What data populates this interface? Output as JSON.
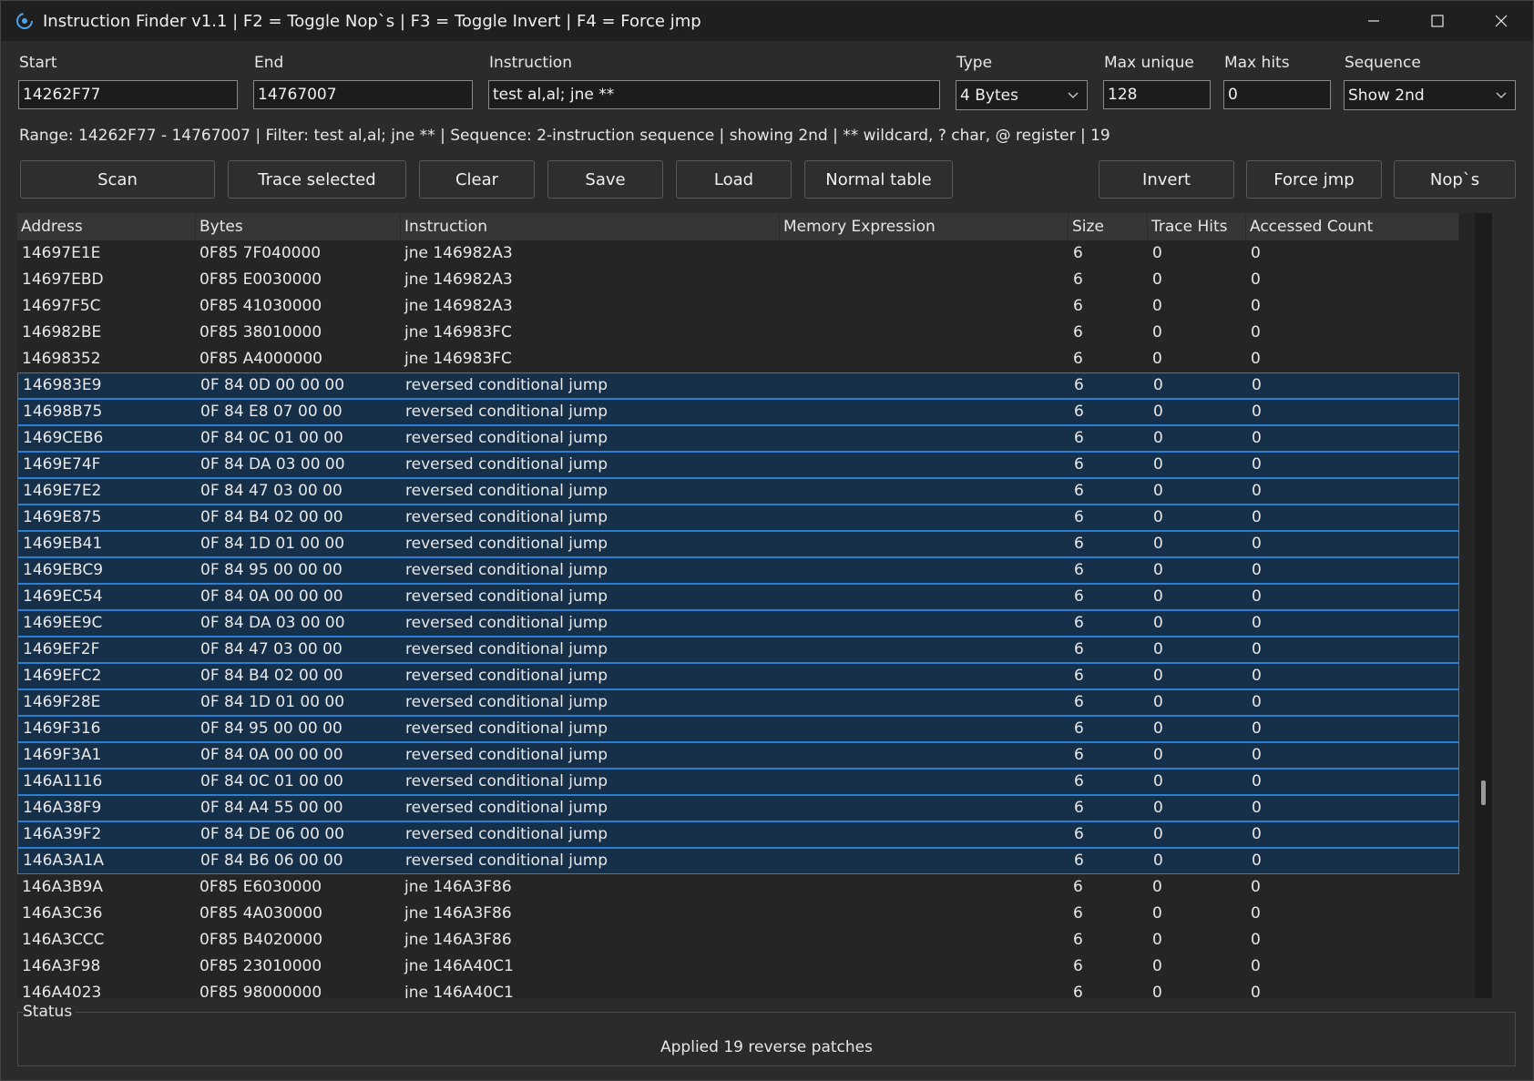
{
  "window": {
    "title": "Instruction Finder v1.1 | F2 = Toggle Nop`s | F3 = Toggle Invert | F4 = Force jmp"
  },
  "fields": {
    "start_label": "Start",
    "start_value": "14262F77",
    "end_label": "End",
    "end_value": "14767007",
    "instruction_label": "Instruction",
    "instruction_value": "test al,al; jne **",
    "type_label": "Type",
    "type_value": "4 Bytes",
    "max_unique_label": "Max unique",
    "max_unique_value": "128",
    "max_hits_label": "Max hits",
    "max_hits_value": "0",
    "sequence_label": "Sequence",
    "sequence_value": "Show 2nd"
  },
  "info": "Range: 14262F77 - 14767007 | Filter: test al,al; jne ** | Sequence: 2-instruction sequence | showing 2nd | ** wildcard, ? char, @ register | 19",
  "buttons": {
    "scan": "Scan",
    "trace": "Trace selected",
    "clear": "Clear",
    "save": "Save",
    "load": "Load",
    "normal_table": "Normal table",
    "invert": "Invert",
    "force_jmp": "Force jmp",
    "nops": "Nop`s"
  },
  "table": {
    "columns": [
      "Address",
      "Bytes",
      "Instruction",
      "Memory Expression",
      "Size",
      "Trace Hits",
      "Accessed Count"
    ],
    "rows": [
      {
        "address": "14697E1E",
        "bytes": "0F85 7F040000",
        "instruction": "jne 146982A3",
        "mem": "",
        "size": "6",
        "hits": "0",
        "count": "0",
        "selected": false
      },
      {
        "address": "14697EBD",
        "bytes": "0F85 E0030000",
        "instruction": "jne 146982A3",
        "mem": "",
        "size": "6",
        "hits": "0",
        "count": "0",
        "selected": false
      },
      {
        "address": "14697F5C",
        "bytes": "0F85 41030000",
        "instruction": "jne 146982A3",
        "mem": "",
        "size": "6",
        "hits": "0",
        "count": "0",
        "selected": false
      },
      {
        "address": "146982BE",
        "bytes": "0F85 38010000",
        "instruction": "jne 146983FC",
        "mem": "",
        "size": "6",
        "hits": "0",
        "count": "0",
        "selected": false
      },
      {
        "address": "14698352",
        "bytes": "0F85 A4000000",
        "instruction": "jne 146983FC",
        "mem": "",
        "size": "6",
        "hits": "0",
        "count": "0",
        "selected": false
      },
      {
        "address": "146983E9",
        "bytes": "0F 84 0D 00 00 00",
        "instruction": "reversed conditional jump",
        "mem": "",
        "size": "6",
        "hits": "0",
        "count": "0",
        "selected": true
      },
      {
        "address": "14698B75",
        "bytes": "0F 84 E8 07 00 00",
        "instruction": "reversed conditional jump",
        "mem": "",
        "size": "6",
        "hits": "0",
        "count": "0",
        "selected": true
      },
      {
        "address": "1469CEB6",
        "bytes": "0F 84 0C 01 00 00",
        "instruction": "reversed conditional jump",
        "mem": "",
        "size": "6",
        "hits": "0",
        "count": "0",
        "selected": true
      },
      {
        "address": "1469E74F",
        "bytes": "0F 84 DA 03 00 00",
        "instruction": "reversed conditional jump",
        "mem": "",
        "size": "6",
        "hits": "0",
        "count": "0",
        "selected": true
      },
      {
        "address": "1469E7E2",
        "bytes": "0F 84 47 03 00 00",
        "instruction": "reversed conditional jump",
        "mem": "",
        "size": "6",
        "hits": "0",
        "count": "0",
        "selected": true
      },
      {
        "address": "1469E875",
        "bytes": "0F 84 B4 02 00 00",
        "instruction": "reversed conditional jump",
        "mem": "",
        "size": "6",
        "hits": "0",
        "count": "0",
        "selected": true
      },
      {
        "address": "1469EB41",
        "bytes": "0F 84 1D 01 00 00",
        "instruction": "reversed conditional jump",
        "mem": "",
        "size": "6",
        "hits": "0",
        "count": "0",
        "selected": true
      },
      {
        "address": "1469EBC9",
        "bytes": "0F 84 95 00 00 00",
        "instruction": "reversed conditional jump",
        "mem": "",
        "size": "6",
        "hits": "0",
        "count": "0",
        "selected": true
      },
      {
        "address": "1469EC54",
        "bytes": "0F 84 0A 00 00 00",
        "instruction": "reversed conditional jump",
        "mem": "",
        "size": "6",
        "hits": "0",
        "count": "0",
        "selected": true
      },
      {
        "address": "1469EE9C",
        "bytes": "0F 84 DA 03 00 00",
        "instruction": "reversed conditional jump",
        "mem": "",
        "size": "6",
        "hits": "0",
        "count": "0",
        "selected": true
      },
      {
        "address": "1469EF2F",
        "bytes": "0F 84 47 03 00 00",
        "instruction": "reversed conditional jump",
        "mem": "",
        "size": "6",
        "hits": "0",
        "count": "0",
        "selected": true
      },
      {
        "address": "1469EFC2",
        "bytes": "0F 84 B4 02 00 00",
        "instruction": "reversed conditional jump",
        "mem": "",
        "size": "6",
        "hits": "0",
        "count": "0",
        "selected": true
      },
      {
        "address": "1469F28E",
        "bytes": "0F 84 1D 01 00 00",
        "instruction": "reversed conditional jump",
        "mem": "",
        "size": "6",
        "hits": "0",
        "count": "0",
        "selected": true
      },
      {
        "address": "1469F316",
        "bytes": "0F 84 95 00 00 00",
        "instruction": "reversed conditional jump",
        "mem": "",
        "size": "6",
        "hits": "0",
        "count": "0",
        "selected": true
      },
      {
        "address": "1469F3A1",
        "bytes": "0F 84 0A 00 00 00",
        "instruction": "reversed conditional jump",
        "mem": "",
        "size": "6",
        "hits": "0",
        "count": "0",
        "selected": true
      },
      {
        "address": "146A1116",
        "bytes": "0F 84 0C 01 00 00",
        "instruction": "reversed conditional jump",
        "mem": "",
        "size": "6",
        "hits": "0",
        "count": "0",
        "selected": true
      },
      {
        "address": "146A38F9",
        "bytes": "0F 84 A4 55 00 00",
        "instruction": "reversed conditional jump",
        "mem": "",
        "size": "6",
        "hits": "0",
        "count": "0",
        "selected": true
      },
      {
        "address": "146A39F2",
        "bytes": "0F 84 DE 06 00 00",
        "instruction": "reversed conditional jump",
        "mem": "",
        "size": "6",
        "hits": "0",
        "count": "0",
        "selected": true
      },
      {
        "address": "146A3A1A",
        "bytes": "0F 84 B6 06 00 00",
        "instruction": "reversed conditional jump",
        "mem": "",
        "size": "6",
        "hits": "0",
        "count": "0",
        "selected": true
      },
      {
        "address": "146A3B9A",
        "bytes": "0F85 E6030000",
        "instruction": "jne 146A3F86",
        "mem": "",
        "size": "6",
        "hits": "0",
        "count": "0",
        "selected": false
      },
      {
        "address": "146A3C36",
        "bytes": "0F85 4A030000",
        "instruction": "jne 146A3F86",
        "mem": "",
        "size": "6",
        "hits": "0",
        "count": "0",
        "selected": false
      },
      {
        "address": "146A3CCC",
        "bytes": "0F85 B4020000",
        "instruction": "jne 146A3F86",
        "mem": "",
        "size": "6",
        "hits": "0",
        "count": "0",
        "selected": false
      },
      {
        "address": "146A3F98",
        "bytes": "0F85 23010000",
        "instruction": "jne 146A40C1",
        "mem": "",
        "size": "6",
        "hits": "0",
        "count": "0",
        "selected": false
      },
      {
        "address": "146A4023",
        "bytes": "0F85 98000000",
        "instruction": "jne 146A40C1",
        "mem": "",
        "size": "6",
        "hits": "0",
        "count": "0",
        "selected": false
      }
    ]
  },
  "status": {
    "label": "Status",
    "text": "Applied 19 reverse patches"
  },
  "colors": {
    "selection_bg": "#16304a",
    "selection_border": "#2a7fd4"
  }
}
